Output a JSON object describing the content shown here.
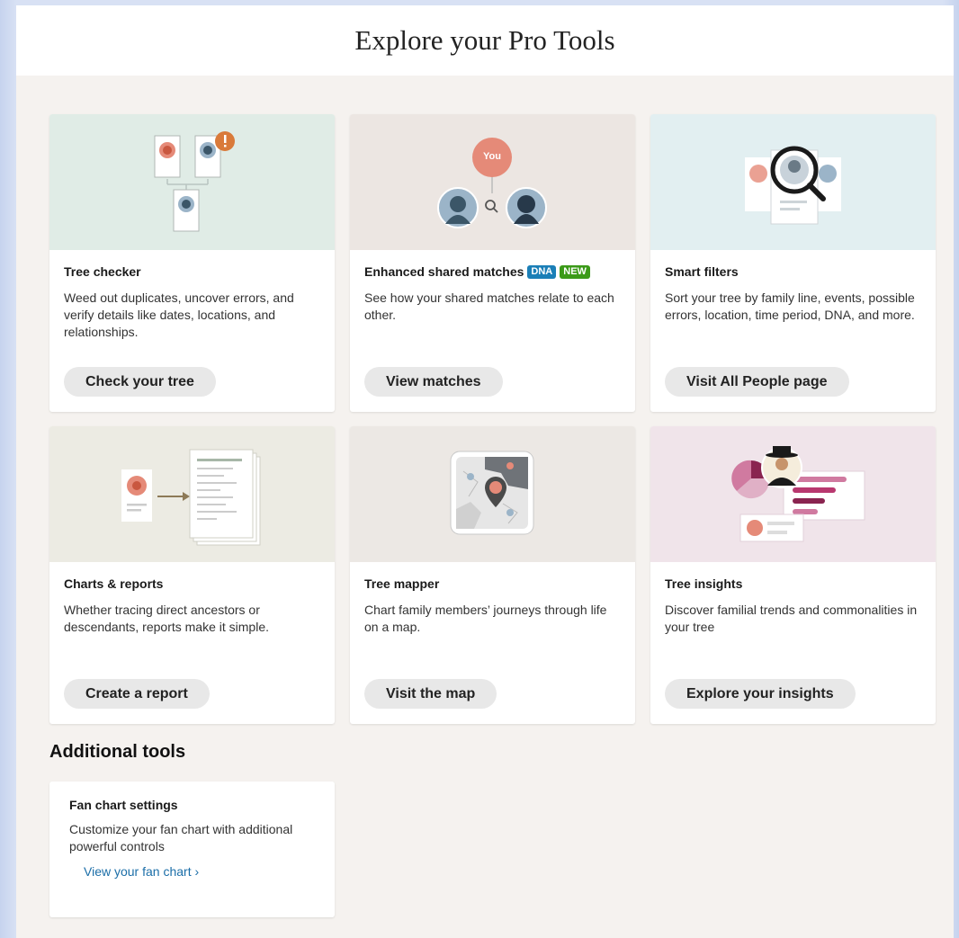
{
  "header": {
    "title": "Explore your Pro Tools"
  },
  "cards": [
    {
      "title": "Tree checker",
      "desc": "Weed out duplicates, uncover errors, and verify details like dates, locations, and relationships.",
      "button": "Check your tree",
      "bg": "#e0ece6"
    },
    {
      "title": "Enhanced shared matches",
      "badges": [
        "DNA",
        "NEW"
      ],
      "desc": "See how your shared matches relate to each other.",
      "button": "View matches",
      "bg": "#ece6e2",
      "illus_label": "You"
    },
    {
      "title": "Smart filters",
      "desc": "Sort your tree by family line, events, possible errors, location, time period, DNA, and more.",
      "button": "Visit All People page",
      "bg": "#e2eff1"
    },
    {
      "title": "Charts & reports",
      "desc": "Whether tracing direct ancestors or descendants, reports make it simple.",
      "button": "Create a report",
      "bg": "#ecebe3"
    },
    {
      "title": "Tree mapper",
      "desc": "Chart family members’ journeys through life on a map.",
      "button": "Visit the map",
      "bg": "#ece8e4"
    },
    {
      "title": "Tree insights",
      "desc": "Discover familial trends and commonalities in your tree",
      "button": "Explore your insights",
      "bg": "#f0e4ea"
    }
  ],
  "additional": {
    "title": "Additional tools",
    "card": {
      "title": "Fan chart settings",
      "desc": "Customize your fan chart with additional powerful controls",
      "link": "View your fan chart"
    },
    "link_icon": "chevron-right-icon"
  },
  "colors": {
    "accent_orange": "#d97a3a",
    "link_blue": "#1b6ea8",
    "dna_badge": "#1b7fb7",
    "new_badge": "#3b9a18"
  }
}
